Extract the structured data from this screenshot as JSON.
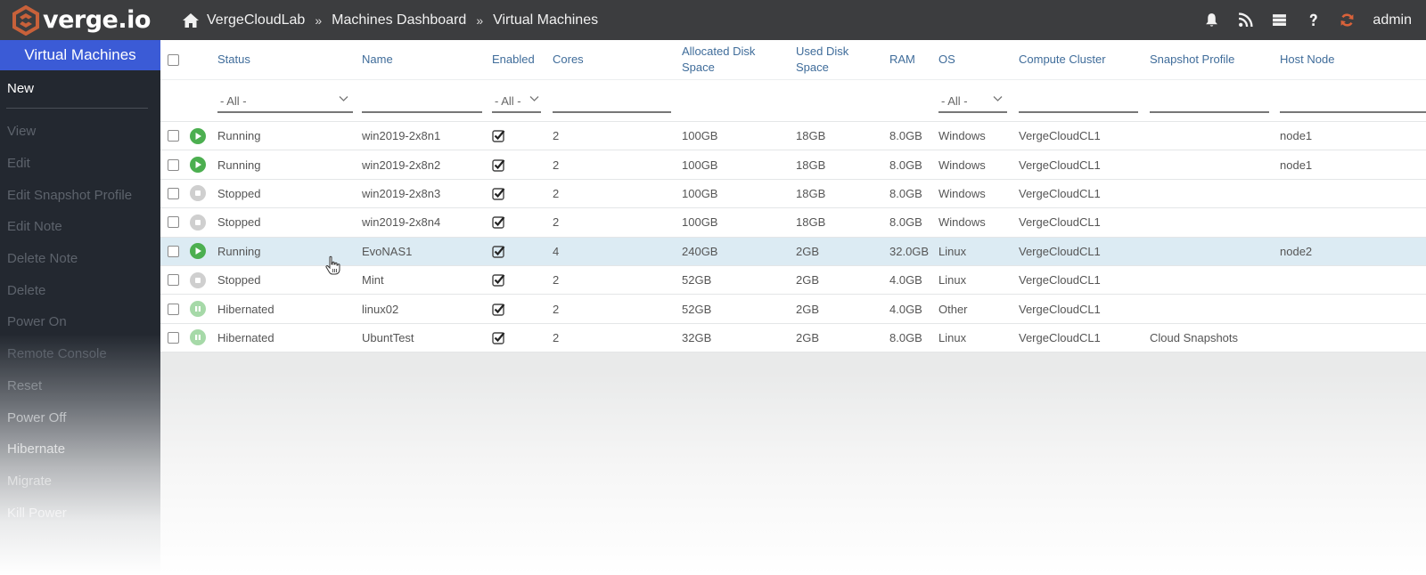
{
  "app": {
    "logo_text": "verge.io",
    "brand_color": "#c8613a",
    "accent_color": "#3b5bd6"
  },
  "breadcrumb": {
    "home_icon": "home-icon",
    "items": [
      "VergeCloudLab",
      "Machines Dashboard",
      "Virtual Machines"
    ],
    "separator": "»"
  },
  "topbar": {
    "icons": [
      "bell-icon",
      "rss-icon",
      "server-list-icon",
      "help-icon",
      "refresh-icon"
    ],
    "user": "admin"
  },
  "sidebar": {
    "title": "Virtual Machines",
    "new_label": "New",
    "items": [
      "View",
      "Edit",
      "Edit Snapshot Profile",
      "Edit Note",
      "Delete Note",
      "Delete",
      "Power On",
      "Remote Console",
      "Reset",
      "Power Off",
      "Hibernate",
      "Migrate",
      "Kill Power"
    ]
  },
  "table": {
    "columns": {
      "status": "Status",
      "name": "Name",
      "enabled": "Enabled",
      "cores": "Cores",
      "alloc_disk": "Allocated Disk Space",
      "used_disk": "Used Disk Space",
      "ram": "RAM",
      "os": "OS",
      "cluster": "Compute Cluster",
      "snapshot": "Snapshot Profile",
      "host": "Host Node"
    },
    "filters": {
      "status": "- All -",
      "enabled": "- All -",
      "os": "- All -"
    },
    "status_colors": {
      "Running": "#4caf50",
      "Stopped": "#cfcfcf",
      "Hibernated": "#a6d9a8"
    },
    "rows": [
      {
        "status": "Running",
        "name": "win2019-2x8n1",
        "enabled": true,
        "cores": "2",
        "alloc_disk": "100GB",
        "used_disk": "18GB",
        "ram": "8.0GB",
        "os": "Windows",
        "cluster": "VergeCloudCL1",
        "snapshot": "",
        "host": "node1",
        "selected": false
      },
      {
        "status": "Running",
        "name": "win2019-2x8n2",
        "enabled": true,
        "cores": "2",
        "alloc_disk": "100GB",
        "used_disk": "18GB",
        "ram": "8.0GB",
        "os": "Windows",
        "cluster": "VergeCloudCL1",
        "snapshot": "",
        "host": "node1",
        "selected": false
      },
      {
        "status": "Stopped",
        "name": "win2019-2x8n3",
        "enabled": true,
        "cores": "2",
        "alloc_disk": "100GB",
        "used_disk": "18GB",
        "ram": "8.0GB",
        "os": "Windows",
        "cluster": "VergeCloudCL1",
        "snapshot": "",
        "host": "",
        "selected": false
      },
      {
        "status": "Stopped",
        "name": "win2019-2x8n4",
        "enabled": true,
        "cores": "2",
        "alloc_disk": "100GB",
        "used_disk": "18GB",
        "ram": "8.0GB",
        "os": "Windows",
        "cluster": "VergeCloudCL1",
        "snapshot": "",
        "host": "",
        "selected": false
      },
      {
        "status": "Running",
        "name": "EvoNAS1",
        "enabled": true,
        "cores": "4",
        "alloc_disk": "240GB",
        "used_disk": "2GB",
        "ram": "32.0GB",
        "os": "Linux",
        "cluster": "VergeCloudCL1",
        "snapshot": "",
        "host": "node2",
        "selected": true
      },
      {
        "status": "Stopped",
        "name": "Mint",
        "enabled": true,
        "cores": "2",
        "alloc_disk": "52GB",
        "used_disk": "2GB",
        "ram": "4.0GB",
        "os": "Linux",
        "cluster": "VergeCloudCL1",
        "snapshot": "",
        "host": "",
        "selected": false
      },
      {
        "status": "Hibernated",
        "name": "linux02",
        "enabled": true,
        "cores": "2",
        "alloc_disk": "52GB",
        "used_disk": "2GB",
        "ram": "4.0GB",
        "os": "Other",
        "cluster": "VergeCloudCL1",
        "snapshot": "",
        "host": "",
        "selected": false
      },
      {
        "status": "Hibernated",
        "name": "UbuntTest",
        "enabled": true,
        "cores": "2",
        "alloc_disk": "32GB",
        "used_disk": "2GB",
        "ram": "8.0GB",
        "os": "Linux",
        "cluster": "VergeCloudCL1",
        "snapshot": "Cloud Snapshots",
        "host": "",
        "selected": false
      }
    ]
  }
}
